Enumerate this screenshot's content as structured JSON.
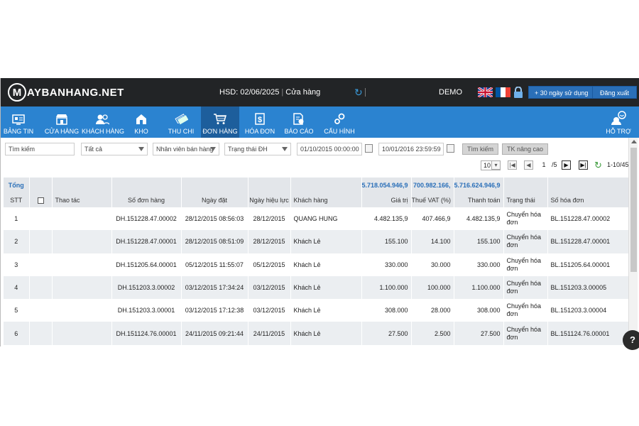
{
  "topbar": {
    "logo_letter": "M",
    "logo_text": "AYBANHANG.NET",
    "hsd": "HSD: 02/06/2025",
    "store": "Cửa hàng",
    "demo": "DEMO",
    "trial_button": "+ 30 ngày sử dụng",
    "logout_button": "Đăng xuất"
  },
  "nav": {
    "items": [
      {
        "label": "BẢNG TIN",
        "icon": "dashboard-icon"
      },
      {
        "label": "CỬA HÀNG",
        "icon": "store-icon"
      },
      {
        "label": "KHÁCH HÀNG",
        "icon": "customers-icon"
      },
      {
        "label": "KHO",
        "icon": "warehouse-icon"
      },
      {
        "label": "THU CHI",
        "icon": "money-icon"
      },
      {
        "label": "ĐƠN HÀNG",
        "icon": "cart-icon"
      },
      {
        "label": "HÓA ĐƠN",
        "icon": "invoice-icon"
      },
      {
        "label": "BÁO CÁO",
        "icon": "report-icon"
      },
      {
        "label": "CẤU HÌNH",
        "icon": "settings-icon"
      }
    ],
    "support": "HỖ TRỢ",
    "active": "ĐƠN HÀNG"
  },
  "filters": {
    "search_placeholder": "Tìm kiếm",
    "category": "Tất cả",
    "staff": "Nhân viên bán hàng",
    "status": "Trạng thái ĐH",
    "date_from": "01/10/2015 00:00:00",
    "date_to": "10/01/2016 23:59:59",
    "search_button": "Tìm kiếm",
    "advanced_button": "TK nâng cao"
  },
  "pager": {
    "page_size": "10",
    "current_page": "1",
    "total_pages": "/5",
    "range": "1-10/45"
  },
  "table": {
    "total_label": "Tổng",
    "totals": {
      "gia_tri": "5.718.054.946,9",
      "thue": "700.982.166,",
      "thanh_toan": "5.716.624.946,9"
    },
    "headers": {
      "stt": "STT",
      "thao_tac": "Thao tác",
      "so_don_hang": "Số đơn hàng",
      "ngay_dat": "Ngày đặt",
      "ngay_hieu_luc": "Ngày hiệu lực",
      "khach_hang": "Khách hàng",
      "gia_tri": "Giá trị",
      "thue": "Thuế VAT (%)",
      "thanh_toan": "Thanh toán",
      "trang_thai": "Trạng thái",
      "so_hoa_don": "Số hóa đơn"
    },
    "rows": [
      {
        "stt": "1",
        "so_don_hang": "DH.151228.47.00002",
        "ngay_dat": "28/12/2015 08:56:03",
        "ngay_hieu_luc": "28/12/2015",
        "khach_hang": "QUANG HUNG",
        "gia_tri": "4.482.135,9",
        "thue": "407.466,9",
        "thanh_toan": "4.482.135,9",
        "trang_thai": "Chuyển hóa đơn",
        "so_hoa_don": "BL.151228.47.00002"
      },
      {
        "stt": "2",
        "so_don_hang": "DH.151228.47.00001",
        "ngay_dat": "28/12/2015 08:51:09",
        "ngay_hieu_luc": "28/12/2015",
        "khach_hang": "Khách Lẻ",
        "gia_tri": "155.100",
        "thue": "14.100",
        "thanh_toan": "155.100",
        "trang_thai": "Chuyển hóa đơn",
        "so_hoa_don": "BL.151228.47.00001"
      },
      {
        "stt": "3",
        "so_don_hang": "DH.151205.64.00001",
        "ngay_dat": "05/12/2015 11:55:07",
        "ngay_hieu_luc": "05/12/2015",
        "khach_hang": "Khách Lẻ",
        "gia_tri": "330.000",
        "thue": "30.000",
        "thanh_toan": "330.000",
        "trang_thai": "Chuyển hóa đơn",
        "so_hoa_don": "BL.151205.64.00001"
      },
      {
        "stt": "4",
        "so_don_hang": "DH.151203.3.00002",
        "ngay_dat": "03/12/2015 17:34:24",
        "ngay_hieu_luc": "03/12/2015",
        "khach_hang": "Khách Lẻ",
        "gia_tri": "1.100.000",
        "thue": "100.000",
        "thanh_toan": "1.100.000",
        "trang_thai": "Chuyển hóa đơn",
        "so_hoa_don": "BL.151203.3.00005"
      },
      {
        "stt": "5",
        "so_don_hang": "DH.151203.3.00001",
        "ngay_dat": "03/12/2015 17:12:38",
        "ngay_hieu_luc": "03/12/2015",
        "khach_hang": "Khách Lẻ",
        "gia_tri": "308.000",
        "thue": "28.000",
        "thanh_toan": "308.000",
        "trang_thai": "Chuyển hóa đơn",
        "so_hoa_don": "BL.151203.3.00004"
      },
      {
        "stt": "6",
        "so_don_hang": "DH.151124.76.00001",
        "ngay_dat": "24/11/2015 09:21:44",
        "ngay_hieu_luc": "24/11/2015",
        "khach_hang": "Khách Lẻ",
        "gia_tri": "27.500",
        "thue": "2.500",
        "thanh_toan": "27.500",
        "trang_thai": "Chuyển hóa đơn",
        "so_hoa_don": "BL.151124.76.00001"
      }
    ]
  },
  "help_fab": "?"
}
